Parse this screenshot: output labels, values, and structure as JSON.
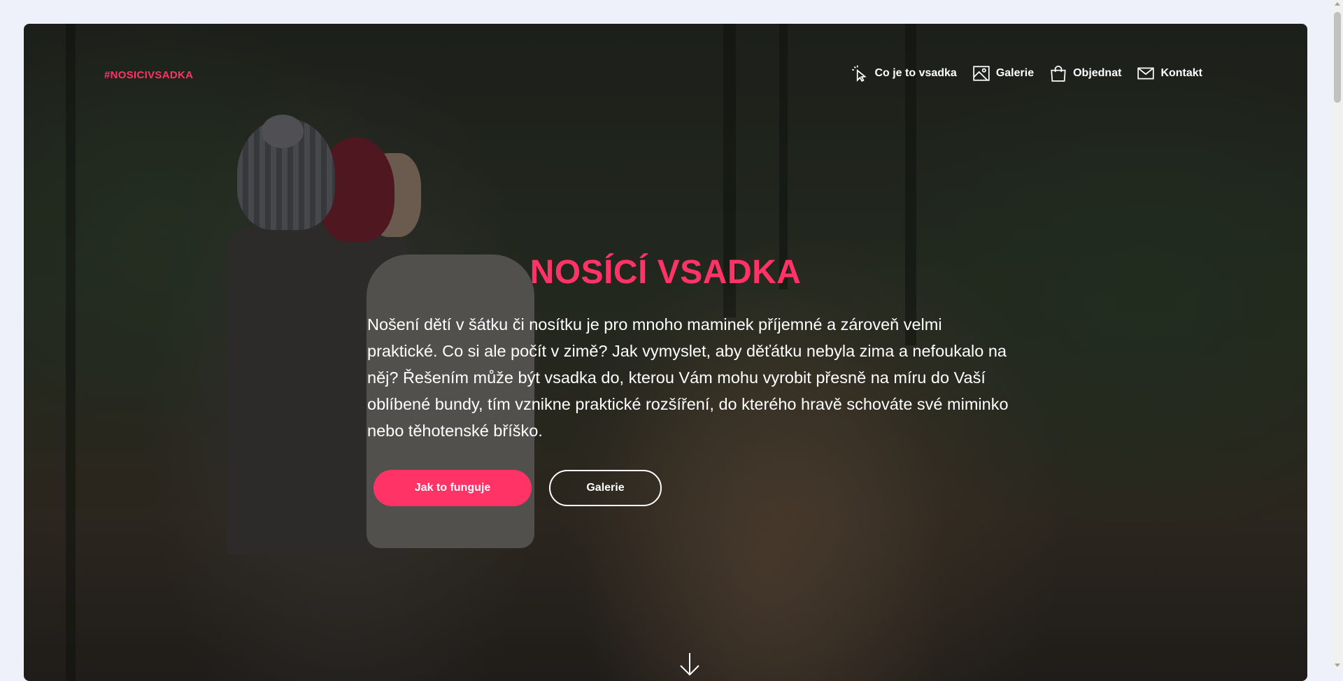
{
  "brand": "#NOSICIVSADKA",
  "nav": [
    {
      "label": "Co je to vsadka",
      "icon": "pointer-click-icon"
    },
    {
      "label": "Galerie",
      "icon": "image-icon"
    },
    {
      "label": "Objednat",
      "icon": "shopping-bag-icon"
    },
    {
      "label": "Kontakt",
      "icon": "mail-icon"
    }
  ],
  "hero": {
    "title": "NOSÍCÍ VSADKA",
    "text": "Nošení dětí v šátku či nosítku je pro mnoho maminek příjemné a zároveň velmi praktické. Co si ale počít v zimě? Jak vymyslet, aby děťátku nebyla zima a nefoukalo na něj? Řešením může být vsadka do, kterou Vám mohu vyrobit přesně na míru do Vaší oblíbené bundy, tím vznikne praktické rozšíření, do kterého hravě schováte své miminko nebo těhotenské bříško.",
    "primary_button": "Jak to funguje",
    "secondary_button": "Galerie",
    "scroll_icon": "arrow-down-icon"
  },
  "colors": {
    "accent": "#ff3366",
    "page_bg": "#eef1f9"
  }
}
